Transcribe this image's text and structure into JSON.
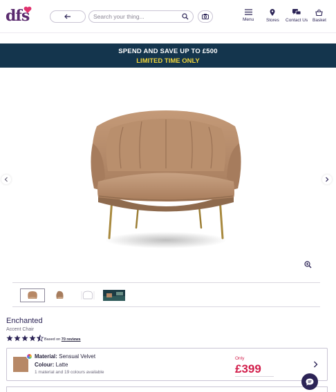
{
  "header": {
    "logo_text": "dfs",
    "search_placeholder": "Search your thing...",
    "nav": [
      {
        "label": "Menu",
        "icon": "menu-icon"
      },
      {
        "label": "Stores",
        "icon": "location-pin-icon"
      },
      {
        "label": "Contact Us",
        "icon": "chat-bubbles-icon"
      },
      {
        "label": "Basket",
        "icon": "basket-icon"
      }
    ]
  },
  "promo": {
    "line1": "SPEND AND SAVE UP TO £500",
    "line2": "LIMITED TIME ONLY"
  },
  "product": {
    "name": "Enchanted",
    "type": "Accent Chair",
    "rating_stars": 4.5,
    "based_on_prefix": "Based on",
    "reviews_link": "70 reviews"
  },
  "option": {
    "material_label": "Material:",
    "material_value": "Sensual Velvet",
    "colour_label": "Colour:",
    "colour_value": "Latte",
    "availability": "1 material and 19 colours available",
    "price_prefix": "Only",
    "price": "£399"
  },
  "colors": {
    "brand": "#5a2a6e",
    "promo_bg": "#14354d",
    "promo_accent": "#f2d63a",
    "price": "#d21e4b",
    "swatch": "#b78866"
  }
}
